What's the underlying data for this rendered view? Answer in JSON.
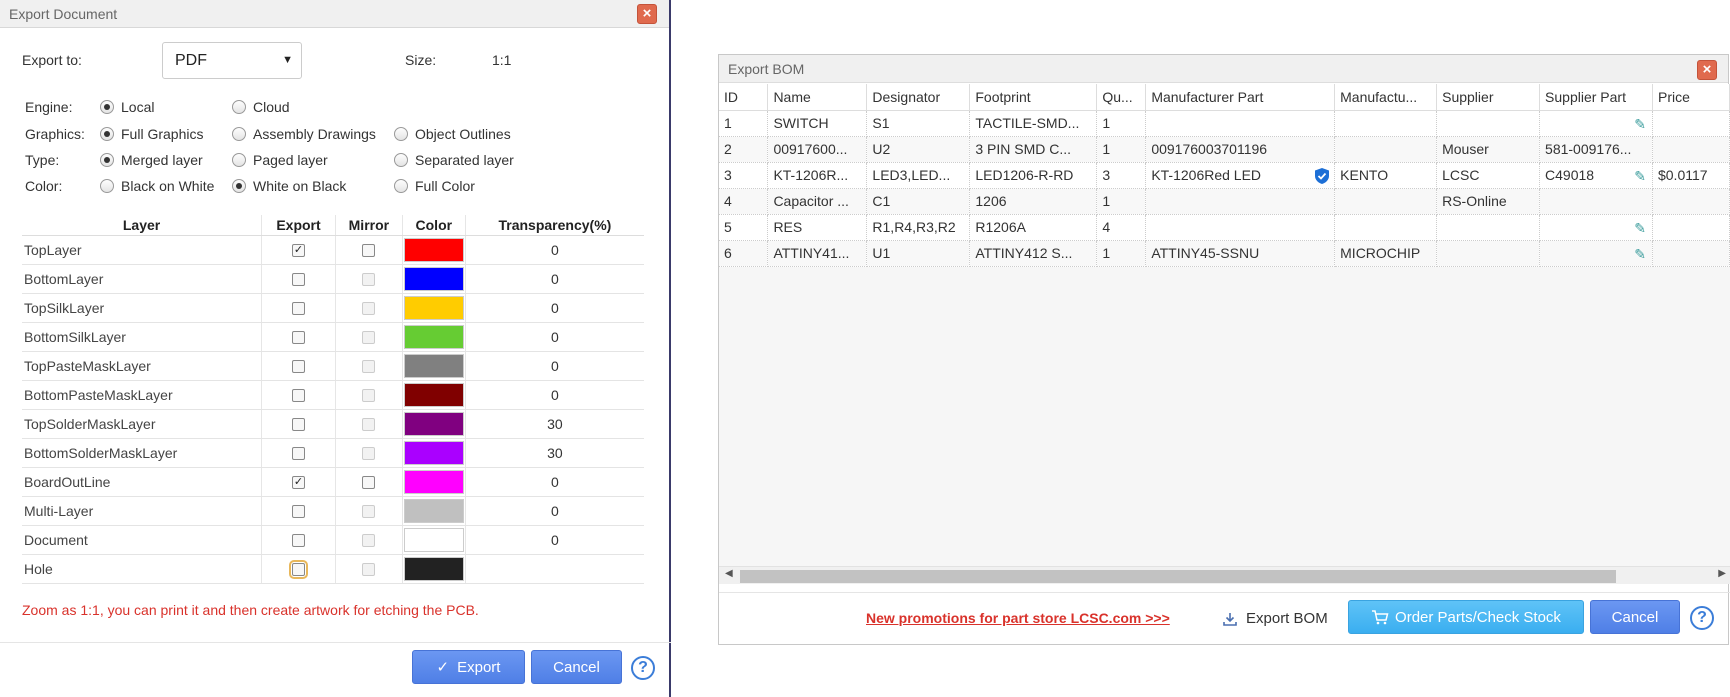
{
  "export_document": {
    "title": "Export Document",
    "close_glyph": "×",
    "export_to_label": "Export to:",
    "export_to_value": "PDF",
    "size_label": "Size:",
    "size_value": "1:1",
    "engine": {
      "label": "Engine:",
      "options": [
        "Local",
        "Cloud"
      ],
      "selected": "Local"
    },
    "graphics": {
      "label": "Graphics:",
      "options": [
        "Full Graphics",
        "Assembly Drawings",
        "Object Outlines"
      ],
      "selected": "Full Graphics"
    },
    "type": {
      "label": "Type:",
      "options": [
        "Merged layer",
        "Paged layer",
        "Separated layer"
      ],
      "selected": "Merged layer"
    },
    "color": {
      "label": "Color:",
      "options": [
        "Black on White",
        "White on Black",
        "Full Color"
      ],
      "selected": "White on Black"
    },
    "table_headers": [
      "Layer",
      "Export",
      "Mirror",
      "Color",
      "Transparency(%)"
    ],
    "layers": [
      {
        "name": "TopLayer",
        "export": true,
        "mirror_enabled": true,
        "mirror": false,
        "color": "#ff0000",
        "transparency": "0"
      },
      {
        "name": "BottomLayer",
        "export": false,
        "mirror_enabled": false,
        "mirror": false,
        "color": "#0000ff",
        "transparency": "0"
      },
      {
        "name": "TopSilkLayer",
        "export": false,
        "mirror_enabled": false,
        "mirror": false,
        "color": "#ffcc00",
        "transparency": "0"
      },
      {
        "name": "BottomSilkLayer",
        "export": false,
        "mirror_enabled": false,
        "mirror": false,
        "color": "#66cc33",
        "transparency": "0"
      },
      {
        "name": "TopPasteMaskLayer",
        "export": false,
        "mirror_enabled": false,
        "mirror": false,
        "color": "#808080",
        "transparency": "0"
      },
      {
        "name": "BottomPasteMaskLayer",
        "export": false,
        "mirror_enabled": false,
        "mirror": false,
        "color": "#800000",
        "transparency": "0"
      },
      {
        "name": "TopSolderMaskLayer",
        "export": false,
        "mirror_enabled": false,
        "mirror": false,
        "color": "#800080",
        "transparency": "30"
      },
      {
        "name": "BottomSolderMaskLayer",
        "export": false,
        "mirror_enabled": false,
        "mirror": false,
        "color": "#aa00ff",
        "transparency": "30"
      },
      {
        "name": "BoardOutLine",
        "export": true,
        "mirror_enabled": true,
        "mirror": false,
        "color": "#ff00ff",
        "transparency": "0"
      },
      {
        "name": "Multi-Layer",
        "export": false,
        "mirror_enabled": false,
        "mirror": false,
        "color": "#c0c0c0",
        "transparency": "0"
      },
      {
        "name": "Document",
        "export": false,
        "mirror_enabled": false,
        "mirror": false,
        "color": "#ffffff",
        "transparency": "0"
      },
      {
        "name": "Hole",
        "export": false,
        "mirror_enabled": false,
        "mirror": false,
        "color": "#222222",
        "transparency": "",
        "focused": true
      }
    ],
    "note": "Zoom as 1:1, you can print it and then create artwork for etching the PCB.",
    "export_button": "Export",
    "cancel_button": "Cancel",
    "help_glyph": "?"
  },
  "export_bom": {
    "title": "Export BOM",
    "close_glyph": "×",
    "columns": [
      "ID",
      "Name",
      "Designator",
      "Footprint",
      "Qu...",
      "Manufacturer Part",
      "Manufactu...",
      "Supplier",
      "Supplier Part",
      "Price"
    ],
    "rows": [
      {
        "cells": [
          "1",
          "SWITCH",
          "S1",
          "TACTILE-SMD...",
          "1",
          "",
          "",
          "",
          "",
          ""
        ],
        "edit": true,
        "verified": false
      },
      {
        "cells": [
          "2",
          "00917600...",
          "U2",
          "3 PIN SMD C...",
          "1",
          "009176003701196",
          "",
          "Mouser",
          "581-009176...",
          ""
        ],
        "edit": false,
        "verified": false
      },
      {
        "cells": [
          "3",
          "KT-1206R...",
          "LED3,LED...",
          "LED1206-R-RD",
          "3",
          "KT-1206Red LED",
          "KENTO",
          "LCSC",
          "C49018",
          "$0.0117"
        ],
        "edit": true,
        "verified": true
      },
      {
        "cells": [
          "4",
          "Capacitor ...",
          "C1",
          "1206",
          "1",
          "",
          "",
          "RS-Online",
          "",
          ""
        ],
        "edit": false,
        "verified": false
      },
      {
        "cells": [
          "5",
          "RES",
          "R1,R4,R3,R2",
          "R1206A",
          "4",
          "",
          "",
          "",
          "",
          ""
        ],
        "edit": true,
        "verified": false
      },
      {
        "cells": [
          "6",
          "ATTINY41...",
          "U1",
          "ATTINY412 S...",
          "1",
          "ATTINY45-SSNU",
          "MICROCHIP",
          "",
          "",
          ""
        ],
        "edit": true,
        "verified": false
      }
    ],
    "promo_link": "New promotions for part store LCSC.com >>>",
    "export_bom_button": "Export BOM",
    "order_button": "Order Parts/Check Stock",
    "cancel_button": "Cancel",
    "help_glyph": "?",
    "scroll_left_glyph": "◀",
    "scroll_right_glyph": "▶"
  },
  "colors": {
    "accent_blue": "#5585ee",
    "accent_cyan": "#44b4f3",
    "warning_red": "#d9322b"
  },
  "icons": [
    "close-icon",
    "chevron-down-icon",
    "checkmark-icon",
    "help-icon",
    "pencil-icon",
    "shield-check-icon",
    "download-icon",
    "cart-icon"
  ]
}
